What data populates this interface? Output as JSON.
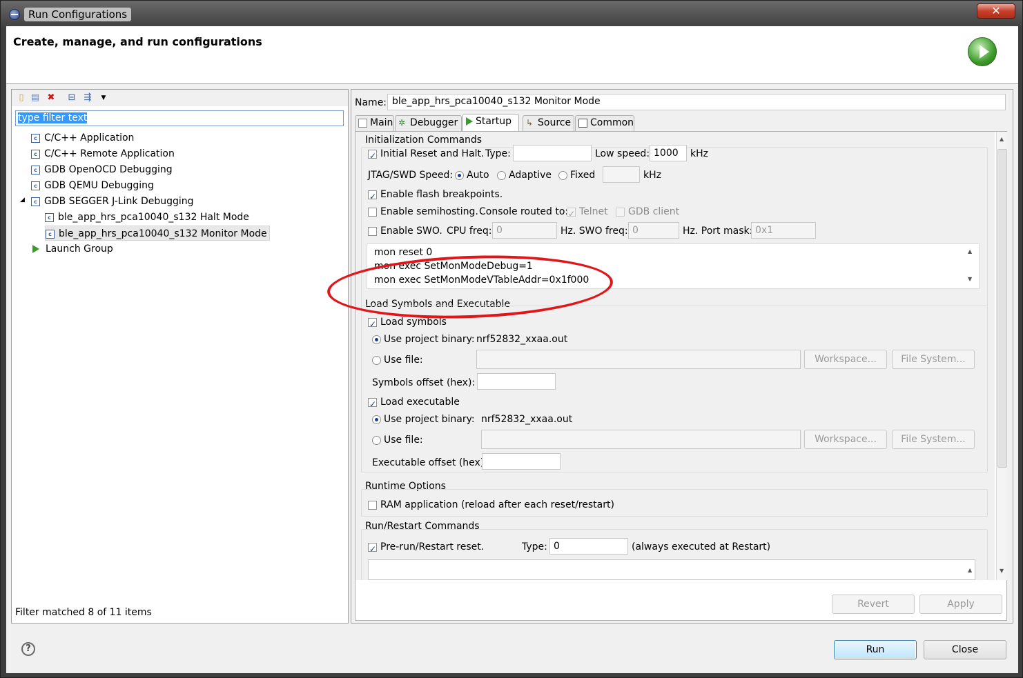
{
  "window": {
    "title": "Run Configurations",
    "close_glyph": "✕"
  },
  "header": {
    "title": "Create, manage, and run configurations"
  },
  "left": {
    "filter_placeholder": "type filter text",
    "tree": [
      {
        "label": "C/C++ Application"
      },
      {
        "label": "C/C++ Remote Application"
      },
      {
        "label": "GDB OpenOCD Debugging"
      },
      {
        "label": "GDB QEMU Debugging"
      },
      {
        "label": "GDB SEGGER J-Link Debugging"
      },
      {
        "label": "ble_app_hrs_pca10040_s132 Halt Mode"
      },
      {
        "label": "ble_app_hrs_pca10040_s132 Monitor Mode"
      },
      {
        "label": "Launch Group"
      }
    ],
    "status": "Filter matched 8 of 11 items"
  },
  "right": {
    "name_label": "Name:",
    "name_value": "ble_app_hrs_pca10040_s132 Monitor Mode",
    "tabs": [
      {
        "label": "Main"
      },
      {
        "label": "Debugger"
      },
      {
        "label": "Startup"
      },
      {
        "label": "Source"
      },
      {
        "label": "Common"
      }
    ],
    "init": {
      "title": "Initialization Commands",
      "initial_reset": "Initial Reset and Halt.",
      "type_label": "Type:",
      "type_value": "",
      "low_speed_label": "Low speed:",
      "low_speed_value": "1000",
      "khz": "kHz",
      "jtag_label": "JTAG/SWD Speed:",
      "auto": "Auto",
      "adaptive": "Adaptive",
      "fixed": "Fixed",
      "fixed_value": "",
      "khz2": "kHz",
      "flash_bp": "Enable flash breakpoints.",
      "semihost": "Enable semihosting.",
      "console_routed": "Console routed to:",
      "telnet": "Telnet",
      "gdb_client": "GDB client",
      "swo": "Enable SWO.",
      "cpu_freq": "CPU freq:",
      "cpu_freq_value": "0",
      "hz_swo": "Hz. SWO freq:",
      "swo_freq_value": "0",
      "hz_port": "Hz. Port mask:",
      "port_mask_value": "0x1",
      "commands": [
        "mon reset 0",
        "mon exec SetMonModeDebug=1",
        "mon exec SetMonModeVTableAddr=0x1f000"
      ]
    },
    "load": {
      "title": "Load Symbols and Executable",
      "load_symbols": "Load symbols",
      "use_project_binary": "Use project binary:",
      "binary_name": "nrf52832_xxaa.out",
      "use_file": "Use file:",
      "workspace": "Workspace...",
      "file_system": "File System...",
      "symbols_offset": "Symbols offset (hex):",
      "load_exec": "Load executable",
      "use_project_binary2": "Use project binary:",
      "binary_name2": "nrf52832_xxaa.out",
      "use_file2": "Use file:",
      "workspace2": "Workspace...",
      "file_system2": "File System...",
      "exec_offset": "Executable offset (hex):"
    },
    "runtime": {
      "title": "Runtime Options",
      "ram_app": "RAM application (reload after each reset/restart)"
    },
    "restart": {
      "title": "Run/Restart Commands",
      "prerun": "Pre-run/Restart reset.",
      "type_label": "Type:",
      "type_value": "0",
      "always": "(always executed at Restart)"
    },
    "revert": "Revert",
    "apply": "Apply"
  },
  "footer": {
    "run": "Run",
    "close": "Close",
    "help_glyph": "?"
  }
}
